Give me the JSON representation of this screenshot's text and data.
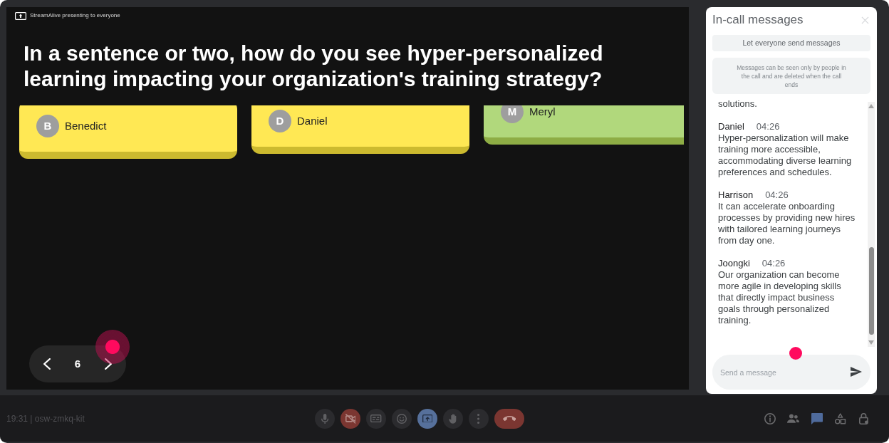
{
  "presentation": {
    "banner": "StreamAlive presenting to everyone",
    "question": "In a sentence or two, how do you see hyper-personalized learning impacting your organization's training strategy?",
    "cards": [
      {
        "initial": "B",
        "name": "Benedict",
        "color": "#ffe854"
      },
      {
        "initial": "D",
        "name": "Daniel",
        "color": "#ffe854"
      },
      {
        "initial": "M",
        "name": "Meryl",
        "color": "#b1d87c"
      }
    ],
    "pager": {
      "page": "6"
    }
  },
  "chat_panel": {
    "title": "In-call messages",
    "toggle_button": "Let everyone send messages",
    "notice": "Messages can be seen only by people in the call and are deleted when the call ends",
    "messages": [
      {
        "kind": "continued",
        "body": "solutions."
      },
      {
        "kind": "message",
        "author": "Daniel",
        "time": "04:26",
        "body": "Hyper-personalization will make training more accessible, accommodating diverse learning preferences and schedules."
      },
      {
        "kind": "message",
        "author": "Harrison",
        "time": "04:26",
        "body": "It can accelerate onboarding processes by providing new hires with tailored learning journeys from day one."
      },
      {
        "kind": "message",
        "author": "Joongki",
        "time": "04:26",
        "body": "Our organization can become more agile in developing skills that directly impact business goals through personalized training."
      }
    ],
    "message_input": {
      "placeholder": "Send a message"
    }
  },
  "toolbar": {
    "meeting_info": "19:31 | osw-zmkq-kit",
    "controls": [
      {
        "kind": "microphone",
        "on": true
      },
      {
        "kind": "camera",
        "on": false
      },
      {
        "kind": "captions",
        "on": false
      },
      {
        "kind": "reactions"
      },
      {
        "kind": "present",
        "on": true
      },
      {
        "kind": "raise-hand",
        "on": false
      },
      {
        "kind": "more"
      },
      {
        "kind": "leave"
      }
    ],
    "panels": [
      {
        "kind": "info",
        "selected": false
      },
      {
        "kind": "people",
        "selected": false
      },
      {
        "kind": "chat",
        "selected": true
      },
      {
        "kind": "activities",
        "selected": false
      },
      {
        "kind": "host-controls",
        "selected": false
      }
    ]
  }
}
